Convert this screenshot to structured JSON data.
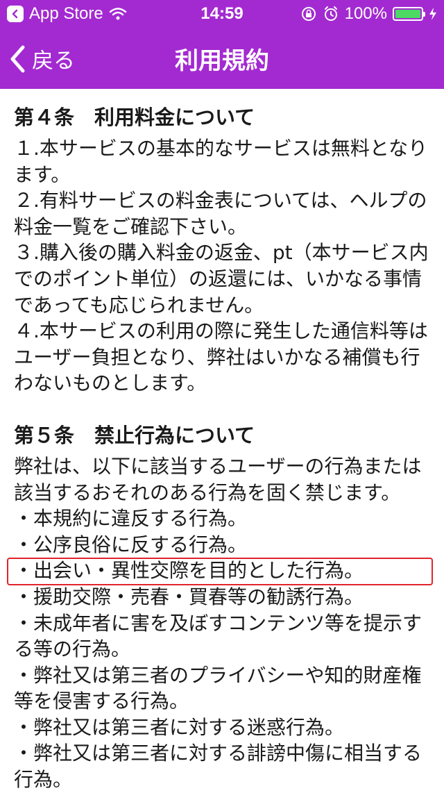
{
  "status_bar": {
    "carrier": "App Store",
    "time": "14:59",
    "battery_percent": "100%",
    "battery_level": 1.0
  },
  "nav": {
    "back_label": "戻る",
    "title": "利用規約"
  },
  "sections": [
    {
      "heading": "第４条　利用料金について",
      "lines": [
        "１.本サービスの基本的なサービスは無料となり",
        "ます。",
        "２.有料サービスの料金表については、ヘルプの",
        "料金一覧をご確認下さい。",
        "３.購入後の購入料金の返金、pt（本サービス内",
        "でのポイント単位）の返還には、いかなる事情",
        "であっても応じられません。",
        "４.本サービスの利用の際に発生した通信料等は",
        "ユーザー負担となり、弊社はいかなる補償も行",
        "わないものとします。"
      ]
    },
    {
      "heading": "第５条　禁止行為について",
      "lines": [
        "弊社は、以下に該当するユーザーの行為または",
        "該当するおそれのある行為を固く禁じます。",
        "・本規約に違反する行為。",
        "・公序良俗に反する行為。",
        "・出会い・異性交際を目的とした行為。",
        "・援助交際・売春・買春等の勧誘行為。",
        "・未成年者に害を及ぼすコンテンツ等を提示す",
        "る等の行為。",
        "・弊社又は第三者のプライバシーや知的財産権",
        "等を侵害する行為。",
        "・弊社又は第三者に対する迷惑行為。",
        "・弊社又は第三者に対する誹謗中傷に相当する",
        "行為。"
      ]
    }
  ],
  "colors": {
    "accent": "#a32ad1",
    "highlight_border": "#e0242a",
    "battery_fill": "#4cd964"
  }
}
